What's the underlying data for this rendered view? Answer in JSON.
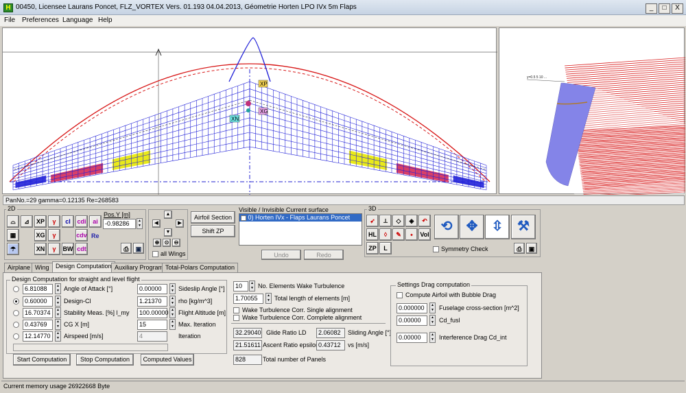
{
  "window": {
    "title": "00450, Licensee Laurans Poncet, FLZ_VORTEX  Vers. 01.193 04.04.2013, Géometrie Horten LPO IVx 5m Flaps",
    "app_icon": "H",
    "minimize": "_",
    "maximize": "□",
    "close": "X"
  },
  "menu": [
    "File",
    "Preferences",
    "Language",
    "Help"
  ],
  "view": {
    "labels": {
      "xp": "XP",
      "xg": "XG",
      "xn": "XN"
    },
    "side_label": "y=0.5 5 10 ..."
  },
  "status_line": "PanNo.=29 gamma=0.12135 Re=268583",
  "memory_status": "Current memory usage 26922668 Byte",
  "panel_2d": {
    "label": "2D",
    "pos_y_label": "Pos.Y [m]",
    "pos_y_value": "-0.98286",
    "all_wings": "all Wings",
    "buttons": [
      "XP",
      "XG",
      "XN",
      "cl",
      "cdi",
      "ai",
      "cdv",
      "Re",
      "BW",
      "cdt"
    ]
  },
  "buttons_mid": {
    "airfoil_section": "Airfoil Section",
    "shift_zp": "Shift ZP"
  },
  "surface_list": {
    "header": "Visible / Invisible    Current surface",
    "items": [
      "0) Horten IVx - Flaps Laurans Poncet"
    ],
    "undo": "Undo",
    "redo": "Redo"
  },
  "panel_3d": {
    "label": "3D",
    "buttons": [
      "HL",
      "ZP",
      "L",
      "Vol"
    ],
    "symmetry_check": "Symmetry Check"
  },
  "tabs": [
    "Airplane",
    "Wing",
    "Design Computation",
    "Auxiliary Programs",
    "Total-Polars Computation"
  ],
  "active_tab": "Design Computation",
  "design": {
    "group_label": "Design Computation for straight and level flight",
    "rows": [
      {
        "value": "6.81088",
        "label": "Angle of Attack [°]",
        "selected": false
      },
      {
        "value": "0.60000",
        "label": "Design-Cl",
        "selected": true
      },
      {
        "value": "16.70374",
        "label": "Stability Meas. [%] l_my",
        "selected": false
      },
      {
        "value": "0.43769",
        "label": "CG X [m]",
        "selected": false
      },
      {
        "value": "12.14770",
        "label": "Airspeed [m/s]",
        "selected": false
      }
    ],
    "params": [
      {
        "value": "0.00000",
        "label": "Sideslip Angle [°]"
      },
      {
        "value": "1.21370",
        "label": "rho [kg/m^3]"
      },
      {
        "value": "100.00000",
        "label": "Flight Altitude [m]"
      },
      {
        "value": "15",
        "label": "Max. Iteration"
      },
      {
        "value": "4",
        "label": "Iteration"
      }
    ],
    "start": "Start Computation",
    "stop": "Stop Computation",
    "computed": "Computed Values"
  },
  "wake": {
    "elements_value": "10",
    "elements_label": "No. Elements Wake Turbulence",
    "length_value": "1.70055",
    "length_label": "Total length of elements [m]",
    "single": "Wake Turbulence Corr. Single alignment",
    "complete": "Wake Turbulence Corr. Complete alignment"
  },
  "results": {
    "glide_value": "32.29040",
    "glide_label": "Glide Ratio LD",
    "sliding_value": "2.06082",
    "sliding_label": "Sliding Angle [°]",
    "ascent_value": "21.51611",
    "ascent_label": "Ascent Ratio epsilon",
    "vs_value": "0.43712",
    "vs_label": "vs [m/s]",
    "panels_value": "828",
    "panels_label": "Total number of Panels"
  },
  "drag": {
    "group_label": "Settings Drag computation",
    "bubble": "Compute Airfoil with Bubble Drag",
    "fuselage_value": "0.000000",
    "fuselage_label": "Fuselage cross-section [m^2]",
    "cdfusl_value": "0.00000",
    "cdfusl_label": "Cd_fusl",
    "interference_value": "0.00000",
    "interference_label": "Interference Drag Cd_int"
  },
  "colors": {
    "mesh": "#2323d8",
    "lift": "#d81818",
    "flap": "#d42a58",
    "aileron": "#e8e800",
    "axis": "#1f1fd0",
    "selection": "#316ac5"
  }
}
